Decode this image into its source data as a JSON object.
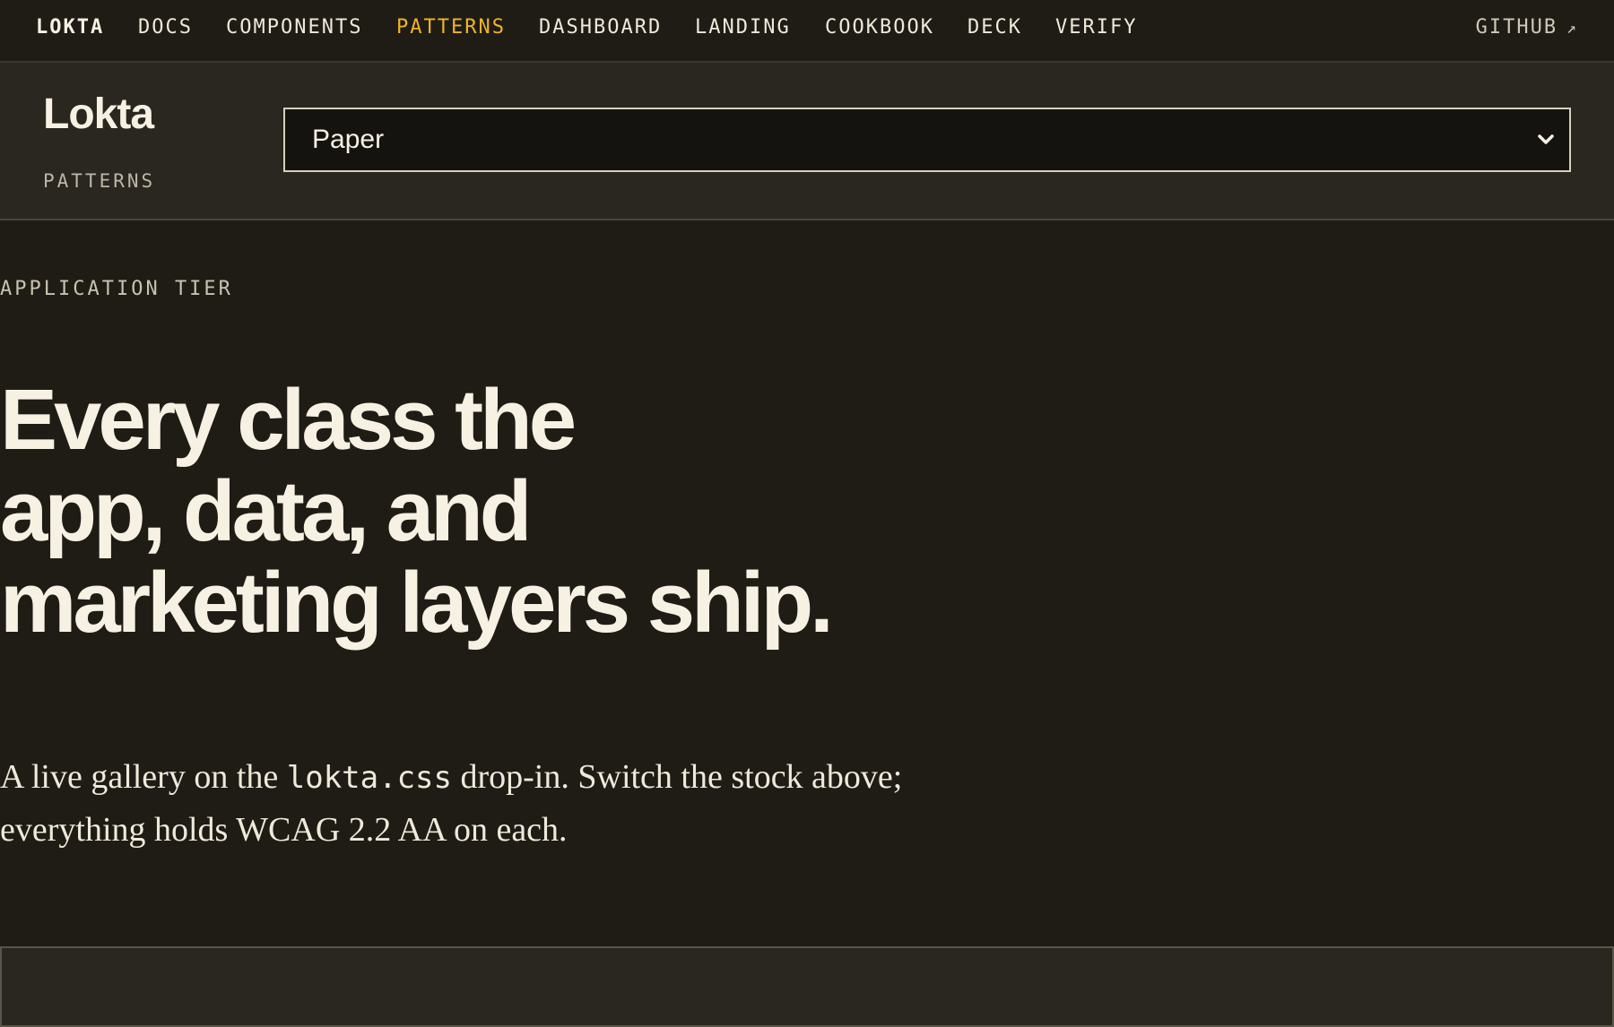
{
  "topnav": {
    "brand": "LOKTA",
    "items": [
      {
        "label": "DOCS"
      },
      {
        "label": "COMPONENTS"
      },
      {
        "label": "PATTERNS",
        "active": true
      },
      {
        "label": "DASHBOARD"
      },
      {
        "label": "LANDING"
      },
      {
        "label": "COOKBOOK"
      },
      {
        "label": "DECK"
      },
      {
        "label": "VERIFY"
      }
    ],
    "github": "GITHUB",
    "github_arrow": "↗"
  },
  "subheader": {
    "logo": "Lokta",
    "section": "PATTERNS",
    "theme_select": {
      "value": "Paper",
      "icon": "chevron-down-icon"
    }
  },
  "hero": {
    "eyebrow": "APPLICATION TIER",
    "title_lines": [
      "Every class the",
      "app, data, and",
      "marketing layers ship."
    ],
    "lede_before": "A live gallery on the ",
    "lede_code": "lokta.css",
    "lede_after": " drop-in. Switch the stock above; everything holds WCAG 2.2 AA on each."
  },
  "colors": {
    "background": "#1f1c16",
    "panel": "#2a2620",
    "accent": "#f0b429",
    "text": "#f6f1e3"
  }
}
